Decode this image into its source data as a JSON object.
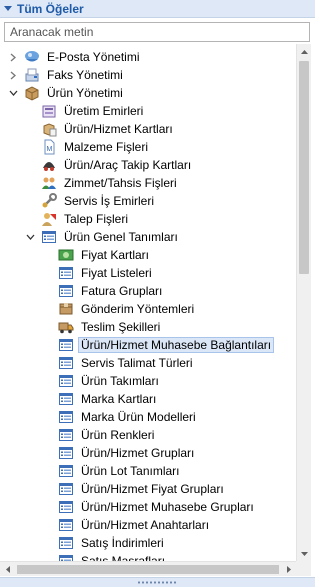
{
  "panel": {
    "title": "Tüm Öğeler"
  },
  "search": {
    "placeholder": "Aranacak metin"
  },
  "tree": {
    "items": [
      {
        "label": "E-Posta Yönetimi",
        "level": 0,
        "expander": "collapsed",
        "icon": "email-icon"
      },
      {
        "label": "Faks Yönetimi",
        "level": 0,
        "expander": "collapsed",
        "icon": "fax-icon"
      },
      {
        "label": "Ürün Yönetimi",
        "level": 0,
        "expander": "expanded",
        "icon": "box-icon"
      },
      {
        "label": "Üretim Emirleri",
        "level": 1,
        "expander": "none",
        "icon": "production-icon"
      },
      {
        "label": "Ürün/Hizmet Kartları",
        "level": 1,
        "expander": "none",
        "icon": "product-card-icon"
      },
      {
        "label": "Malzeme Fişleri",
        "level": 1,
        "expander": "none",
        "icon": "document-icon"
      },
      {
        "label": "Ürün/Araç Takip Kartları",
        "level": 1,
        "expander": "none",
        "icon": "tracking-icon"
      },
      {
        "label": "Zimmet/Tahsis Fişleri",
        "level": 1,
        "expander": "none",
        "icon": "users-icon"
      },
      {
        "label": "Servis İş Emirleri",
        "level": 1,
        "expander": "none",
        "icon": "service-icon"
      },
      {
        "label": "Talep Fişleri",
        "level": 1,
        "expander": "none",
        "icon": "request-icon"
      },
      {
        "label": "Ürün Genel Tanımları",
        "level": 1,
        "expander": "expanded",
        "icon": "list-icon"
      },
      {
        "label": "Fiyat Kartları",
        "level": 2,
        "expander": "none",
        "icon": "price-card-icon"
      },
      {
        "label": "Fiyat Listeleri",
        "level": 2,
        "expander": "none",
        "icon": "list-icon"
      },
      {
        "label": "Fatura Grupları",
        "level": 2,
        "expander": "none",
        "icon": "list-icon"
      },
      {
        "label": "Gönderim Yöntemleri",
        "level": 2,
        "expander": "none",
        "icon": "shipping-icon"
      },
      {
        "label": "Teslim Şekilleri",
        "level": 2,
        "expander": "none",
        "icon": "truck-icon"
      },
      {
        "label": "Ürün/Hizmet Muhasebe Bağlantıları",
        "level": 2,
        "expander": "none",
        "icon": "list-icon",
        "selected": true
      },
      {
        "label": "Servis Talimat Türleri",
        "level": 2,
        "expander": "none",
        "icon": "list-icon"
      },
      {
        "label": "Ürün Takımları",
        "level": 2,
        "expander": "none",
        "icon": "list-icon"
      },
      {
        "label": "Marka Kartları",
        "level": 2,
        "expander": "none",
        "icon": "list-icon"
      },
      {
        "label": "Marka Ürün Modelleri",
        "level": 2,
        "expander": "none",
        "icon": "list-icon"
      },
      {
        "label": "Ürün Renkleri",
        "level": 2,
        "expander": "none",
        "icon": "list-icon"
      },
      {
        "label": "Ürün/Hizmet Grupları",
        "level": 2,
        "expander": "none",
        "icon": "list-icon"
      },
      {
        "label": "Ürün Lot Tanımları",
        "level": 2,
        "expander": "none",
        "icon": "list-icon"
      },
      {
        "label": "Ürün/Hizmet Fiyat Grupları",
        "level": 2,
        "expander": "none",
        "icon": "list-icon"
      },
      {
        "label": "Ürün/Hizmet Muhasebe Grupları",
        "level": 2,
        "expander": "none",
        "icon": "list-icon"
      },
      {
        "label": "Ürün/Hizmet Anahtarları",
        "level": 2,
        "expander": "none",
        "icon": "list-icon"
      },
      {
        "label": "Satış İndirimleri",
        "level": 2,
        "expander": "none",
        "icon": "list-icon"
      },
      {
        "label": "Satış Masrafları",
        "level": 2,
        "expander": "none",
        "icon": "list-icon"
      }
    ]
  },
  "colors": {
    "accent": "#1e5aa8",
    "header_bg": "#dfe8f6",
    "selection_bg": "#dbe7f7",
    "selection_border": "#a9c4eb"
  }
}
